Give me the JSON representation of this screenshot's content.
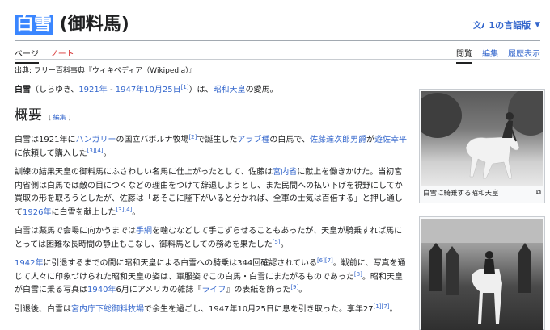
{
  "page": {
    "title_highlight": "白雪",
    "title_rest": " (御料馬)",
    "lang_button": "1の言語版"
  },
  "tabs_left": [
    {
      "label": "ページ"
    },
    {
      "label": "ノート"
    }
  ],
  "tabs_right": [
    {
      "label": "閲覧"
    },
    {
      "label": "編集"
    },
    {
      "label": "履歴表示"
    }
  ],
  "source": "出典: フリー百科事典『ウィキペディア（Wikipedia）』",
  "lead": {
    "name": "白雪",
    "reading": "（しらゆき、",
    "birth": "1921年",
    "dash": " - ",
    "death": "1947年10月25日",
    "ref": "[1]",
    "is": "）は、",
    "owner": "昭和天皇",
    "end": "の愛馬。"
  },
  "section": {
    "heading": "概要",
    "edit_open": "[ ",
    "edit_label": "編集",
    "edit_close": " ]"
  },
  "p1": {
    "t1": "白雪は1921年に",
    "l1": "ハンガリー",
    "t2": "の国立バボルナ牧場",
    "r1": "[2]",
    "t3": "で誕生した",
    "l2": "アラブ種",
    "t4": "の白馬で、",
    "l3": "佐藤達次郎男爵",
    "t5": "が",
    "l4": "遊佐幸平",
    "t6": "に依頼して購入した",
    "r2": "[3]",
    "r3": "[4]",
    "t7": "。"
  },
  "p2": {
    "t1": "訓練の結果天皇の御料馬にふさわしい名馬に仕上がったとして、佐藤は",
    "l1": "宮内省",
    "t2": "に献上を働きかけた。当初宮内省側は白馬では敵の目につくなどの理由をつけて辞退しようとし、また民間への払い下げを視野にしてか買取の形を取ろうとしたが、佐藤は「あそこに陛下がいると分かれば、全軍の士気は百倍する」と押し通して",
    "l2": "1926年",
    "t3": "に白雪を献上した",
    "r1": "[3]",
    "r2": "[4]",
    "t4": "。"
  },
  "p3": {
    "t1": "白雪は薬馬で会場に向かうまでは",
    "l1": "手綱",
    "t2": "を噛むなどして手こずらせることもあったが、天皇が騎乗すれば馬にとっては困難な長時間の静止もこなし、御料馬としての務めを果たした",
    "r1": "[5]",
    "t3": "。"
  },
  "p4": {
    "l1": "1942年",
    "t1": "に引退するまでの間に昭和天皇による白雪への騎乗は344回確認されている",
    "r1": "[6]",
    "r2": "[7]",
    "t2": "。戦前に、写真を通じて人々に印象づけられた昭和天皇の姿は、軍服姿でこの白馬・白雪にまたがるものであった",
    "r3": "[8]",
    "t3": "。昭和天皇が白雪に乗る写真は",
    "l2": "1940年",
    "t4": "6月にアメリカの雑誌『",
    "l3": "ライフ",
    "t5": "』の表紙を飾った",
    "r4": "[9]",
    "t6": "。"
  },
  "p5": {
    "t1": "引退後、白雪は",
    "l1": "宮内庁下総御料牧場",
    "t2": "で余生を過ごし、1947年10月25日に息を引き取った。享年27",
    "r1": "[1]",
    "r2": "[7]",
    "t3": "。"
  },
  "figure1": {
    "caption": "白雪に騎乗する昭和天皇"
  },
  "colors": {
    "link": "#3366cc",
    "new_link": "#d73333",
    "highlight": "#3a86ff"
  }
}
